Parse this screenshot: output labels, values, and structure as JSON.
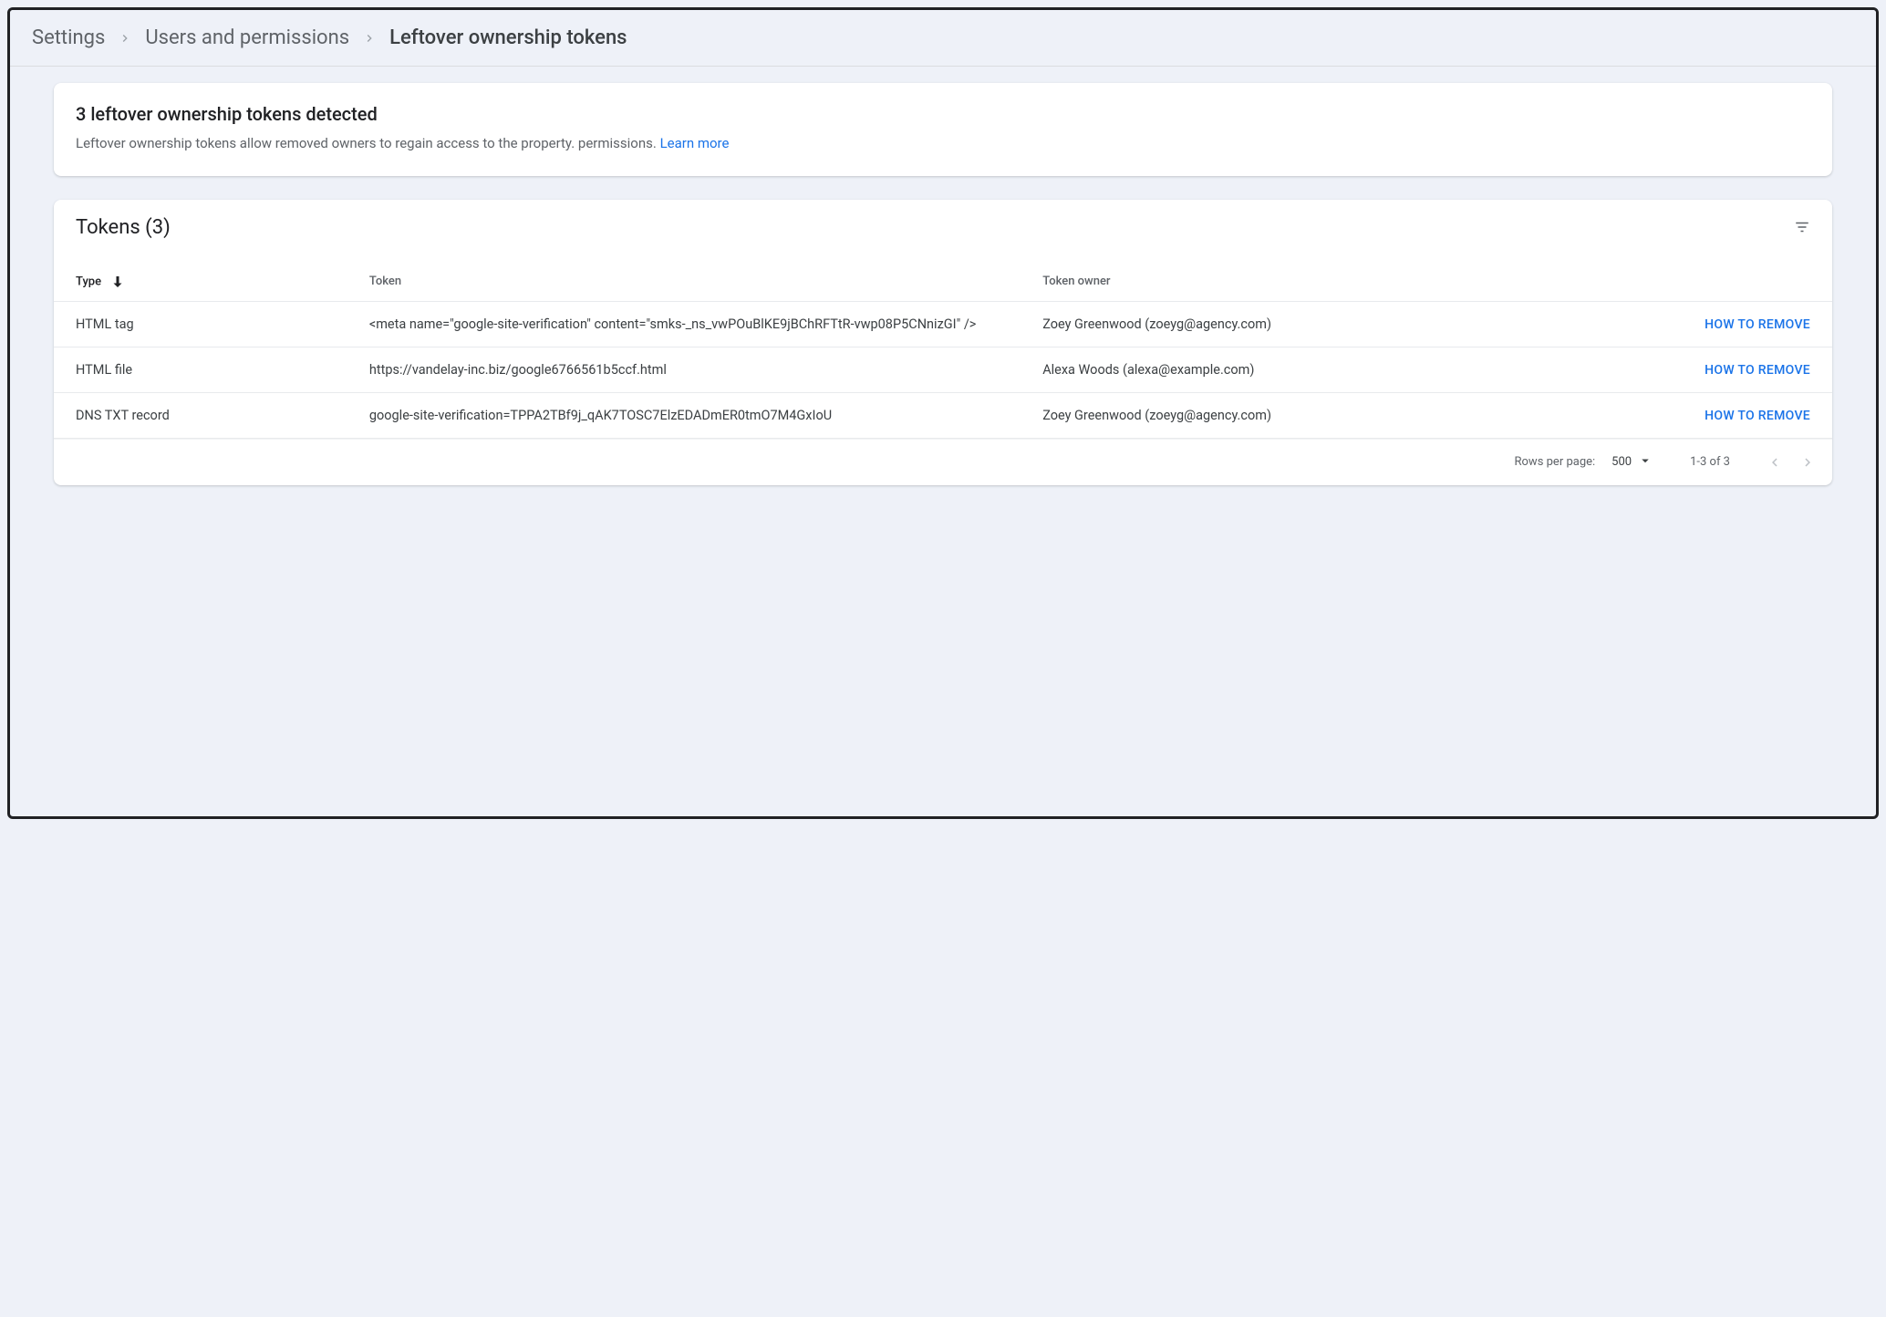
{
  "breadcrumb": {
    "items": [
      "Settings",
      "Users and permissions",
      "Leftover ownership tokens"
    ]
  },
  "banner": {
    "title": "3 leftover ownership tokens detected",
    "body_prefix": "Leftover ownership tokens allow removed owners to regain access to the property. permissions. ",
    "learn_more": "Learn more"
  },
  "tokens": {
    "heading": "Tokens (3)",
    "columns": {
      "type": "Type",
      "token": "Token",
      "owner": "Token owner"
    },
    "action_label": "HOW TO REMOVE",
    "rows": [
      {
        "type": "HTML tag",
        "token": "<meta name=\"google-site-verification\" content=\"smks-_ns_vwPOuBlKE9jBChRFTtR-vwp08P5CNnizGI\" />",
        "owner": "Zoey Greenwood (zoeyg@agency.com)"
      },
      {
        "type": "HTML file",
        "token": "https://vandelay-inc.biz/google6766561b5ccf.html",
        "owner": "Alexa Woods (alexa@example.com)"
      },
      {
        "type": "DNS TXT record",
        "token": "google-site-verification=TPPA2TBf9j_qAK7TOSC7ElzEDADmER0tmO7M4GxIoU",
        "owner": "Zoey Greenwood (zoeyg@agency.com)"
      }
    ]
  },
  "pager": {
    "rows_per_page_label": "Rows per page:",
    "rows_per_page_value": "500",
    "range": "1-3 of 3"
  }
}
